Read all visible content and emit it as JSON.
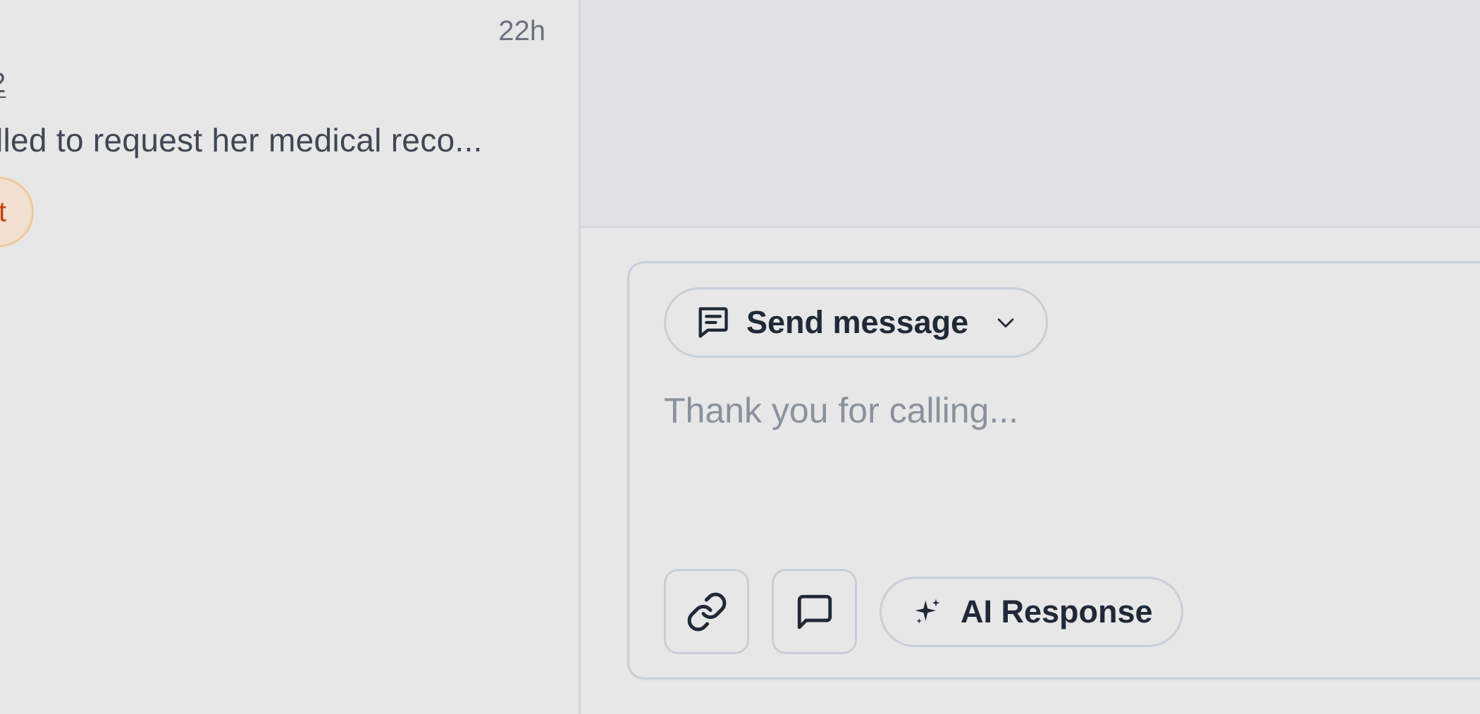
{
  "conversation_list": {
    "item": {
      "time": "22h",
      "id_fragment": "2",
      "preview": "lled to request her medical reco...",
      "badge_text": "t"
    }
  },
  "composer": {
    "mode_label": "Send message",
    "placeholder": "Thank you for calling...",
    "ai_label": "AI Response",
    "icons": {
      "mode": "message-square-text-icon",
      "mode_dropdown": "chevron-down-icon",
      "link": "link-icon",
      "comment": "message-square-icon",
      "ai": "sparkles-icon"
    }
  },
  "colors": {
    "text_dark": "#1f2937",
    "text_muted": "#6b7280",
    "placeholder": "#8a919e",
    "border": "#c8ced8",
    "badge_bg": "#f1dfcf",
    "badge_text": "#c2410c"
  }
}
